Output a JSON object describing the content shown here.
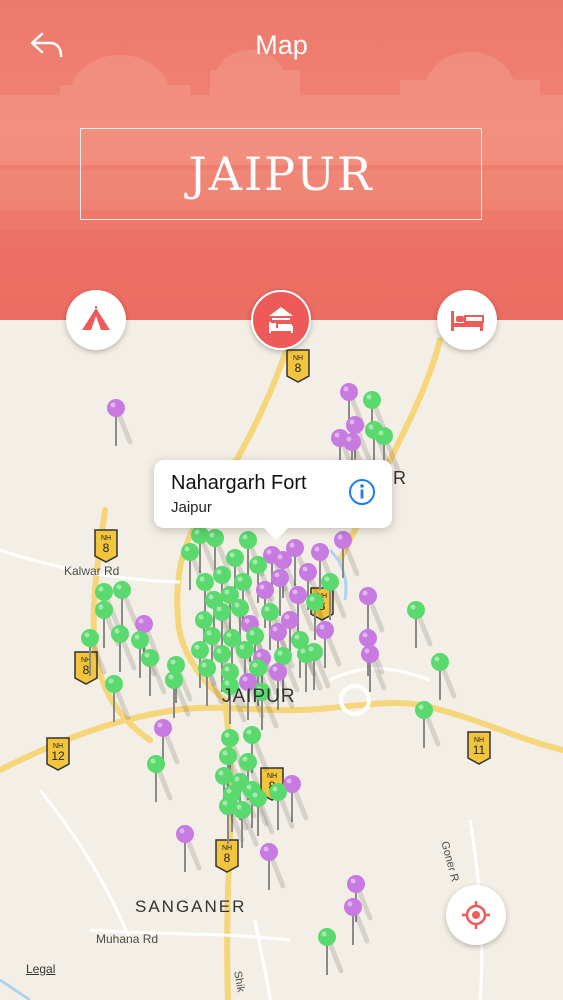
{
  "header": {
    "title": "Map",
    "back_icon": "back-arrow-icon"
  },
  "hero": {
    "city": "JAIPUR",
    "color": "#f08273"
  },
  "categories": [
    {
      "name": "attractions",
      "icon": "tent-icon",
      "active": false
    },
    {
      "name": "sights",
      "icon": "museum-bed-icon",
      "active": true
    },
    {
      "name": "hotels",
      "icon": "bed-icon",
      "active": false
    }
  ],
  "map": {
    "labels": {
      "jaipur": "JAIPUR",
      "sanganer": "SANGANER",
      "kalwar_rd": "Kalwar Rd",
      "muhana_rd": "Muhana Rd",
      "goner": "Goner R",
      "shik": "Shik",
      "r_partial": "R"
    },
    "shields": [
      {
        "top": "NH",
        "num": "8"
      },
      {
        "top": "NH",
        "num": "8"
      },
      {
        "top": "NH",
        "num": "8"
      },
      {
        "top": "NH",
        "num": "8"
      },
      {
        "top": "NH",
        "num": "11"
      },
      {
        "top": "NH",
        "num": "12"
      },
      {
        "top": "NH",
        "num": "8"
      },
      {
        "top": "NH",
        "num": "8"
      }
    ],
    "pin_colors": {
      "green": "#5ad96e",
      "purple": "#c77ae0"
    },
    "callout": {
      "title": "Nahargarh Fort",
      "subtitle": "Jaipur",
      "info_icon": "info-icon"
    },
    "legal": "Legal",
    "locate_icon": "crosshair-icon"
  }
}
